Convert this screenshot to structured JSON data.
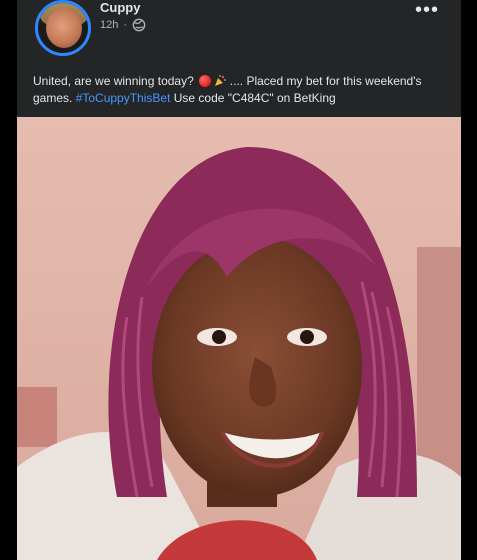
{
  "post": {
    "author": "Cuppy",
    "time": "12h",
    "separator": "·",
    "privacy_icon": "globe-icon",
    "more_label": "•••",
    "text_part1": "United, are we winning today?",
    "text_part2": " .... Placed my bet for this weekend's games. ",
    "hashtag": "#ToCuppyThisBet",
    "text_part3": " Use code \"C484C\" on BetKing"
  },
  "colors": {
    "card_bg": "#242526",
    "text": "#e4e6eb",
    "muted": "#b0b3b8",
    "link": "#4599ff",
    "avatar_ring": "#2d88ff"
  }
}
